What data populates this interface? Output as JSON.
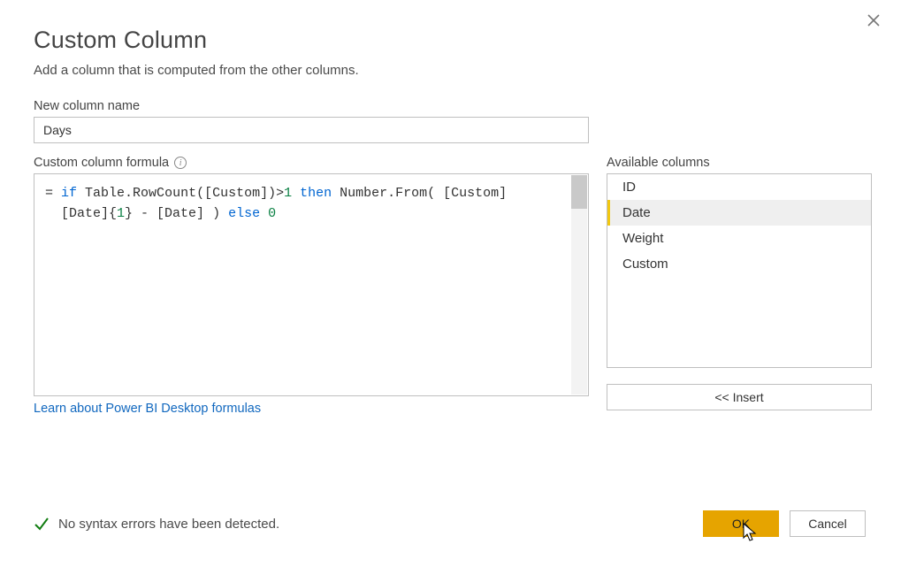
{
  "dialog": {
    "title": "Custom Column",
    "subtitle": "Add a column that is computed from the other columns."
  },
  "name_field": {
    "label": "New column name",
    "value": "Days"
  },
  "formula_field": {
    "label": "Custom column formula"
  },
  "formula": {
    "eq": "=",
    "kw_if": "if",
    "seg1": " Table.RowCount([Custom])>",
    "num1": "1",
    "sp1": " ",
    "kw_then": "then",
    "seg2": " Number.From( [Custom]",
    "line2a": "[Date]{",
    "num2": "1",
    "line2b": "} - [Date] ) ",
    "kw_else": "else",
    "sp2": " ",
    "num3": "0"
  },
  "available": {
    "label": "Available columns",
    "items": [
      {
        "label": "ID",
        "selected": false
      },
      {
        "label": "Date",
        "selected": true
      },
      {
        "label": "Weight",
        "selected": false
      },
      {
        "label": "Custom",
        "selected": false
      }
    ],
    "insert_label": "<< Insert"
  },
  "learn_link": "Learn about Power BI Desktop formulas",
  "status_text": "No syntax errors have been detected.",
  "buttons": {
    "ok": "OK",
    "cancel": "Cancel"
  }
}
